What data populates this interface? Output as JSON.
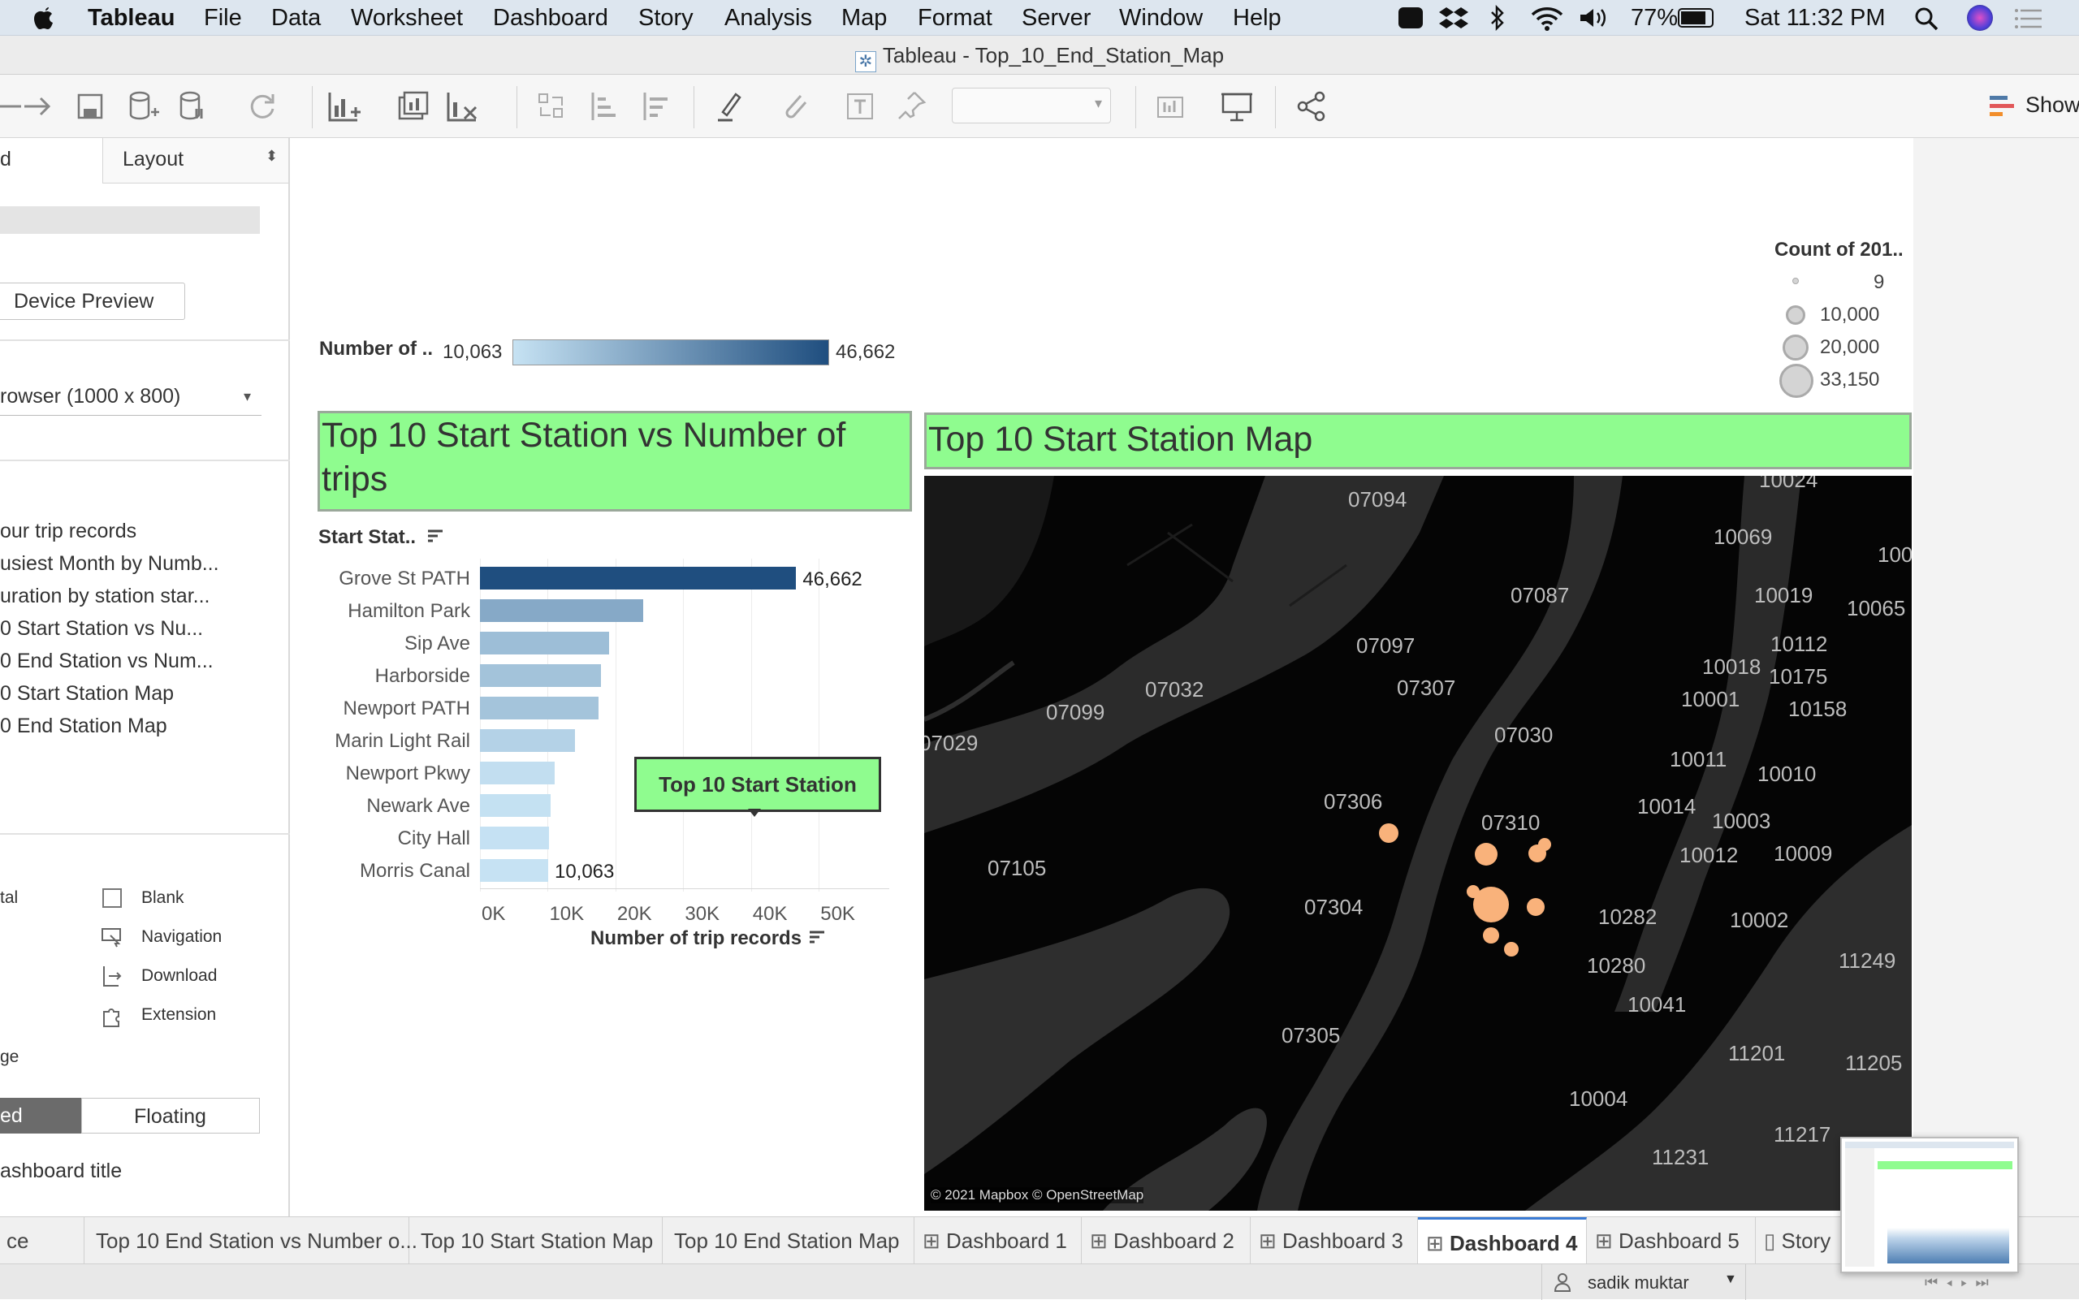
{
  "menubar": {
    "app": "Tableau",
    "items": [
      "File",
      "Data",
      "Worksheet",
      "Dashboard",
      "Story",
      "Analysis",
      "Map",
      "Format",
      "Server",
      "Window",
      "Help"
    ],
    "battery": "77%",
    "clock": "Sat 11:32 PM"
  },
  "window": {
    "title": "Tableau - Top_10_End_Station_Map"
  },
  "toolbar": {
    "show_label": "Show"
  },
  "left": {
    "tab_partial": "d",
    "layout_tab": "Layout",
    "device_preview": "Device Preview",
    "size_value": "rowser (1000 x 800)",
    "sheets": [
      "our trip records",
      "usiest Month by Numb...",
      "uration by station star...",
      "0 Start Station vs Nu...",
      "0 End Station vs Num...",
      "0 Start Station Map",
      "0 End Station Map"
    ],
    "objects": [
      "Blank",
      "Navigation",
      "Download",
      "Extension"
    ],
    "objects_left": [
      "tal",
      "ge"
    ],
    "tiled_partial": "ed",
    "floating": "Floating",
    "dash_title": "ashboard title"
  },
  "color_legend": {
    "title": "Number of ..",
    "min": "10,063",
    "max": "46,662",
    "from": "#c6e2f3",
    "to": "#1f4e7f"
  },
  "size_legend": {
    "title": "Count of 201..",
    "values": [
      "9",
      "10,000",
      "20,000",
      "33,150"
    ]
  },
  "bar_panel": {
    "title": "Top 10 Start Station vs Number of trips",
    "field_label": "Start Stat..",
    "tooltip": "Top 10 Start Station"
  },
  "chart_data": {
    "type": "bar",
    "orientation": "horizontal",
    "categories": [
      "Grove St PATH",
      "Hamilton Park",
      "Sip Ave",
      "Harborside",
      "Newport PATH",
      "Marin Light Rail",
      "Newport Pkwy",
      "Newark Ave",
      "City Hall",
      "Morris Canal"
    ],
    "values": [
      46662,
      24100,
      19000,
      17800,
      17500,
      14000,
      11000,
      10400,
      10200,
      10063
    ],
    "data_labels": {
      "0": "46,662",
      "9": "10,063"
    },
    "xlabel": "Number of trip records",
    "xticks": [
      "0K",
      "10K",
      "20K",
      "30K",
      "40K",
      "50K"
    ],
    "xlim": [
      0,
      58000
    ],
    "grid": true
  },
  "map_panel": {
    "title": "Top 10 Start Station Map",
    "attribution": "© 2021 Mapbox © OpenStreetMap",
    "zips": [
      "10024",
      "07094",
      "10069",
      "100",
      "07087",
      "10019",
      "10065",
      "07097",
      "10112",
      "10018",
      "10175",
      "07032",
      "07307",
      "10001",
      "10158",
      "07099",
      "07030",
      "07029",
      "10011",
      "10010",
      "07306",
      "10014",
      "07310",
      "10003",
      "10012",
      "10009",
      "07105",
      "07304",
      "10282",
      "10002",
      "10280",
      "11249",
      "10041",
      "07305",
      "11201",
      "11205",
      "10004",
      "11217",
      "11231"
    ]
  },
  "tabs": [
    "ce",
    "Top 10 End Station vs Number o...",
    "Top 10 Start Station Map",
    "Top 10 End Station Map",
    "Dashboard 1",
    "Dashboard 2",
    "Dashboard 3",
    "Dashboard 4",
    "Dashboard 5",
    "Story"
  ],
  "active_tab": "Dashboard 4",
  "status": {
    "user": "sadik muktar"
  }
}
